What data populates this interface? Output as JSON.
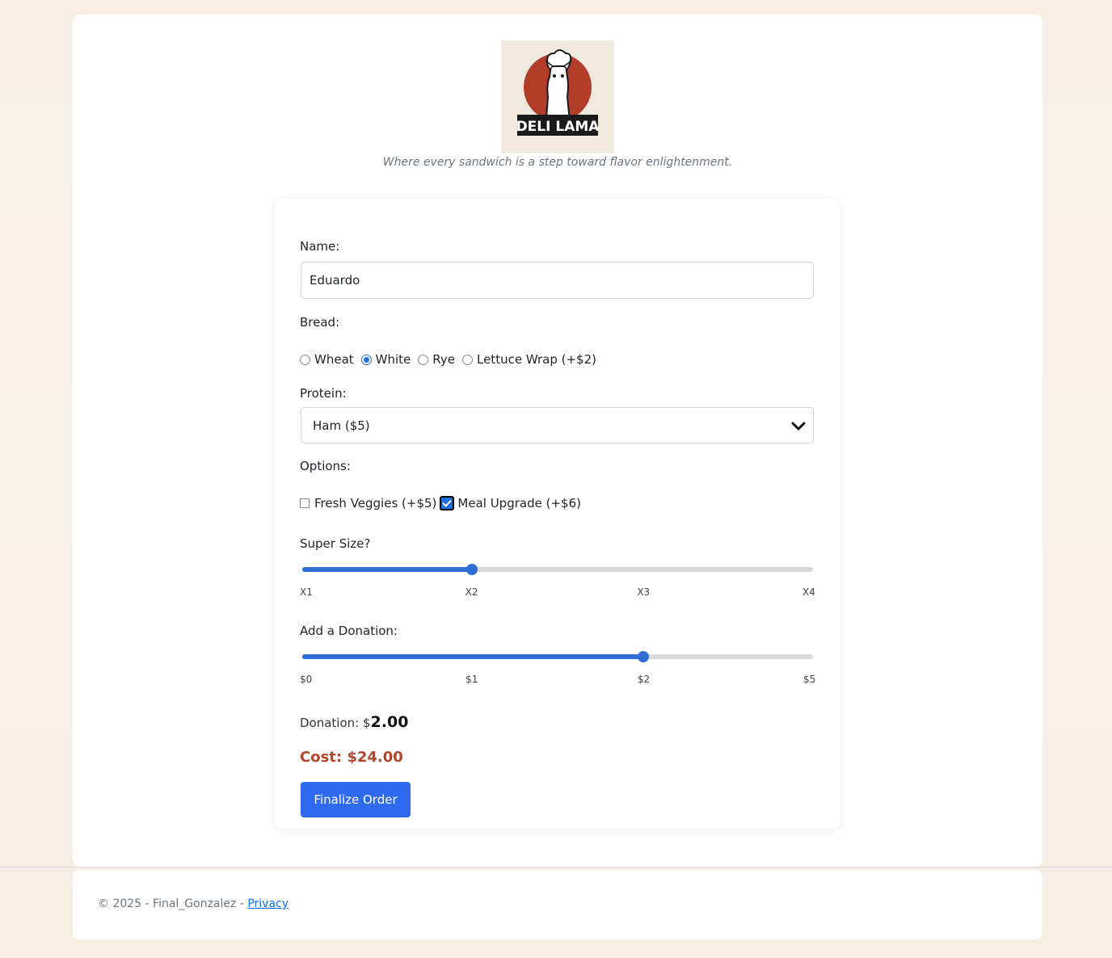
{
  "brand": {
    "logo_text": "DELI LAMA",
    "tagline": "Where every sandwich is a step toward flavor enlightenment."
  },
  "form": {
    "name_label": "Name:",
    "name_value": "Eduardo",
    "bread_label": "Bread:",
    "bread_options": [
      {
        "label": "Wheat",
        "checked": false
      },
      {
        "label": "White",
        "checked": true
      },
      {
        "label": "Rye",
        "checked": false
      },
      {
        "label": "Lettuce Wrap (+$2)",
        "checked": false
      }
    ],
    "protein_label": "Protein:",
    "protein_value": "Ham ($5)",
    "options_label": "Options:",
    "options": [
      {
        "label": "Fresh Veggies (+$5)",
        "checked": false
      },
      {
        "label": "Meal Upgrade (+$6)",
        "checked": true
      }
    ],
    "supersize_label": "Super Size?",
    "supersize_ticks": [
      "X1",
      "X2",
      "X3",
      "X4"
    ],
    "supersize_value": "X2",
    "supersize_fraction": 0.333,
    "donation_label": "Add a Donation:",
    "donation_ticks": [
      "$0",
      "$1",
      "$2",
      "$5"
    ],
    "donation_fraction": 0.667,
    "donation_text_prefix": "Donation: $",
    "donation_amount": "2.00",
    "cost_text": "Cost: $24.00",
    "submit_label": "Finalize Order"
  },
  "footer": {
    "text": "© 2025 - Final_Gonzalez - ",
    "privacy_link": "Privacy"
  },
  "colors": {
    "accent": "#2f6bf0",
    "cost": "#b5452b",
    "logo_circle": "#b23e2a"
  }
}
